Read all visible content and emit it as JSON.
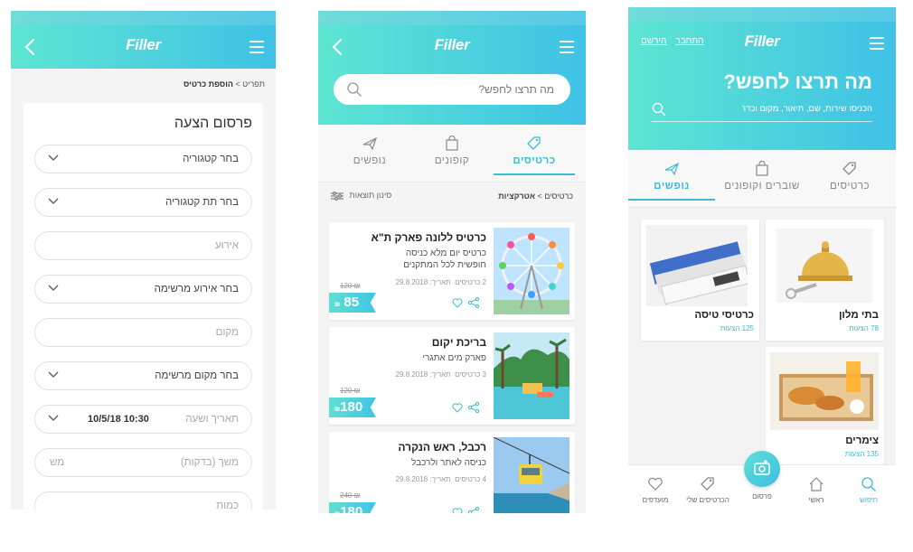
{
  "brand": {
    "logo": "Filler",
    "accent": "#3bbcd8",
    "gradient_start": "#5de5d2",
    "gradient_end": "#3fc2e6"
  },
  "screen1": {
    "breadcrumb_parent": "תפריט",
    "breadcrumb_sep": " > ",
    "breadcrumb_current": "הוספת כרטיס",
    "form_title": "פרסום הצעה",
    "fields": {
      "category": "בחר קטגוריה",
      "subcategory": "בחר תת קטגוריה",
      "event": "אירוע",
      "event_list": "בחר אירוע מרשימה",
      "place": "מקום",
      "place_list": "בחר מקום מרשימה",
      "datetime_label": "תאריך ושעה",
      "datetime_value": "10/5/18 10:30",
      "duration_label": "משך (בדקות)",
      "duration_unit": "מש",
      "last_partial": "כמות"
    }
  },
  "screen2": {
    "search_placeholder": "מה תרצו לחפש?",
    "tabs": {
      "tickets": "כרטיסים",
      "coupons": "קופונים",
      "flights": "נופשים"
    },
    "breadcrumb": "כרטיסים > ",
    "breadcrumb_current": "אטרקציות",
    "sort_label": "סינון תוצאות",
    "items": [
      {
        "title": "כרטיס ללונה פארק ת\"א",
        "desc": "כרטיס יום מלא כניסה חופשית לכל המתקנים",
        "count": "2 כרטיסים",
        "date": "תאריך: 29.8.2018",
        "old_price": "120 ₪",
        "price": "85",
        "currency": "₪"
      },
      {
        "title": "בריכת יקום",
        "desc": "פארק מים אתגרי",
        "count": "3 כרטיסים",
        "date": "תאריך: 29.8.2018",
        "old_price": "120 ₪",
        "price": "180",
        "currency": "₪"
      },
      {
        "title": "רכבל, ראש הנקרה",
        "desc": "כניסה לאתר ולרכבל",
        "count": "4 כרטיסים",
        "date": "תאריך: 29.8.2018",
        "old_price": "240 ₪",
        "price": "180",
        "currency": "₪"
      }
    ]
  },
  "screen3": {
    "login": "התחבר",
    "register": "הירשם",
    "headline": "מה תרצו לחפש?",
    "search_placeholder": "הכניסו שירות, שם, תיאור, מקום וכדו'",
    "tabs": {
      "tickets": "כרטיסים",
      "vouchers": "שוברים וקופונים",
      "vacations": "נופשים"
    },
    "tiles": [
      {
        "title": "בתי מלון",
        "count": "78 הצעות"
      },
      {
        "title": "כרטיסי טיסה",
        "count": "125 הצעות"
      },
      {
        "title": "צימרים",
        "count": "135 הצעות"
      }
    ],
    "nav": {
      "search": "חיפוש",
      "home": "ראשי",
      "post": "פרסום",
      "my_tickets": "הכרטיסים שלי",
      "favorites": "מועדפים"
    }
  }
}
